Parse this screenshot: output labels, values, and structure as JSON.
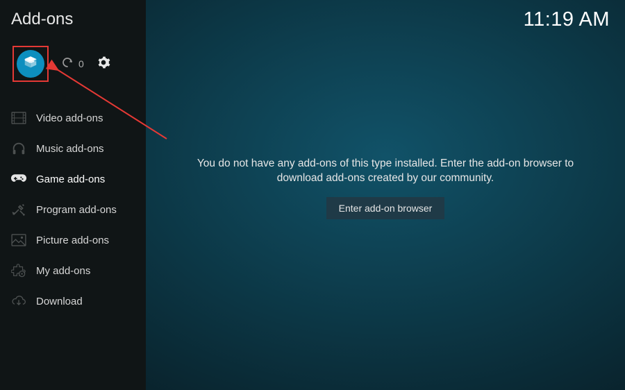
{
  "header": {
    "title": "Add-ons"
  },
  "clock": "11:19 AM",
  "top_bar": {
    "refresh_count": "0"
  },
  "sidebar": {
    "items": [
      {
        "label": "Video add-ons",
        "icon": "film",
        "state": "dim"
      },
      {
        "label": "Music add-ons",
        "icon": "headphones",
        "state": "dim"
      },
      {
        "label": "Game add-ons",
        "icon": "gamepad",
        "state": "active"
      },
      {
        "label": "Program add-ons",
        "icon": "wand",
        "state": "dim"
      },
      {
        "label": "Picture add-ons",
        "icon": "picture",
        "state": "dim"
      },
      {
        "label": "My add-ons",
        "icon": "puzzle-gear",
        "state": "dim"
      },
      {
        "label": "Download",
        "icon": "cloud-down",
        "state": "dim"
      }
    ]
  },
  "main": {
    "empty_message": "You do not have any add-ons of this type installed. Enter the add-on browser to download add-ons created by our community.",
    "enter_button": "Enter add-on browser"
  },
  "colors": {
    "highlight_border": "#e53935",
    "accent_circle": "#0d8fbf"
  }
}
